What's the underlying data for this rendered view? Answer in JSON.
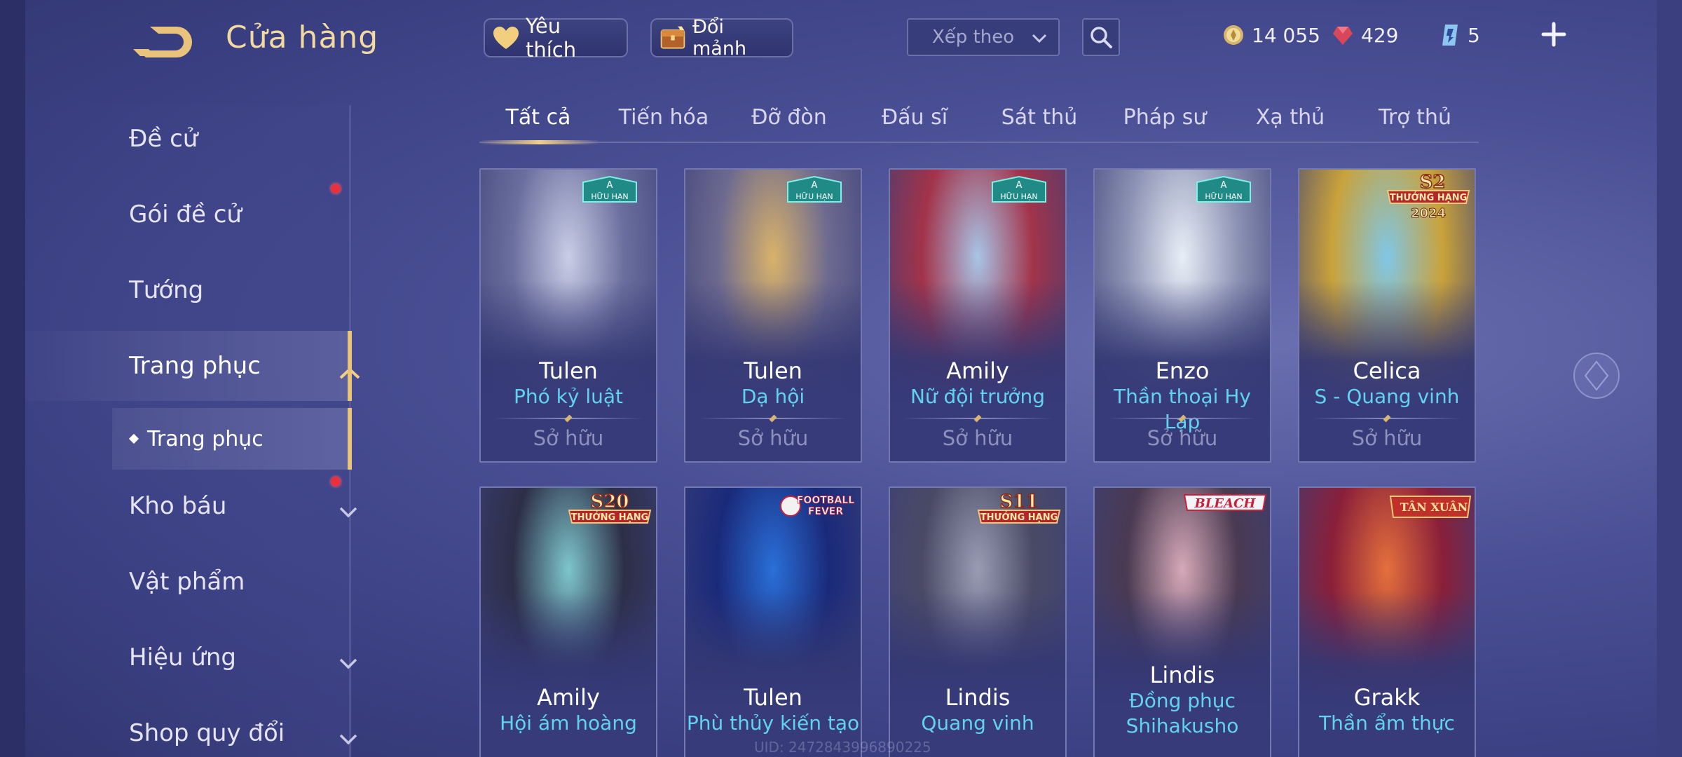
{
  "header": {
    "title": "Cửa hàng",
    "favorite_label": "Yêu thích",
    "fragment_label": "Đổi mảnh",
    "sort_placeholder": "Xếp theo"
  },
  "currency": {
    "gold": "14 055",
    "ruby": "429",
    "voucher": "5"
  },
  "sidebar": {
    "items": [
      {
        "label": "Đề cử"
      },
      {
        "label": "Gói đề cử"
      },
      {
        "label": "Tướng"
      },
      {
        "label": "Trang phục"
      },
      {
        "label": "Kho báu"
      },
      {
        "label": "Vật phẩm"
      },
      {
        "label": "Hiệu ứng"
      },
      {
        "label": "Shop quy đổi"
      }
    ],
    "sub_item": "Trang phục"
  },
  "tabs": [
    "Tất cả",
    "Tiến hóa",
    "Đỡ đòn",
    "Đấu sĩ",
    "Sát thủ",
    "Pháp sư",
    "Xạ thủ",
    "Trợ thủ"
  ],
  "badges": {
    "limited_letter": "A",
    "limited_text": "HỮU HẠN",
    "rank_reward": "THƯỞNG HẠNG",
    "s2": "S2",
    "year_2024": "2024",
    "s20": "S20",
    "s11": "S11",
    "football_1": "FOOTBALL",
    "football_2": "FEVER",
    "bleach": "BLEACH",
    "tan_xuan": "TÂN XUÂN"
  },
  "cards": [
    {
      "hero": "Tulen",
      "skin": "Phó kỷ luật",
      "status": "Sở hữu",
      "colors": [
        "#c9cde6",
        "#6b6f9e",
        "#3b3f78"
      ]
    },
    {
      "hero": "Tulen",
      "skin": "Dạ hội",
      "status": "Sở hữu",
      "colors": [
        "#d9b26a",
        "#6d6a90",
        "#3a3e78"
      ]
    },
    {
      "hero": "Amily",
      "skin": "Nữ đội trưởng",
      "status": "Sở hữu",
      "colors": [
        "#a8c4e6",
        "#a2334a",
        "#3b3f78"
      ]
    },
    {
      "hero": "Enzo",
      "skin": "Thần thoại Hy Lạp",
      "status": "Sở hữu",
      "colors": [
        "#e8eef6",
        "#8d93b4",
        "#3b3f78"
      ]
    },
    {
      "hero": "Celica",
      "skin": "S - Quang vinh",
      "status": "Sở hữu",
      "colors": [
        "#7fc7e6",
        "#c9a23a",
        "#3b3f78"
      ]
    },
    {
      "hero": "Amily",
      "skin": "Hội ám hoàng",
      "status": "",
      "colors": [
        "#7ec6cc",
        "#2d2f48",
        "#3b3f78"
      ]
    },
    {
      "hero": "Tulen",
      "skin": "Phù thủy kiến tạo",
      "status": "",
      "colors": [
        "#2a6fd8",
        "#1a2a7a",
        "#3b3f78"
      ]
    },
    {
      "hero": "Lindis",
      "skin": "Quang vinh",
      "status": "",
      "colors": [
        "#9a9cb4",
        "#4a4a66",
        "#3b3f78"
      ]
    },
    {
      "hero": "Lindis",
      "skin": "Đồng phục Shihakusho",
      "status": "",
      "colors": [
        "#d6a9b8",
        "#4a3a52",
        "#3b3f78"
      ]
    },
    {
      "hero": "Grakk",
      "skin": "Thần ẩm thực",
      "status": "",
      "colors": [
        "#e4703c",
        "#8a1f3a",
        "#3b3f78"
      ]
    }
  ],
  "footer_id": "UID: 2472843996890225",
  "theme": {
    "gold": "#f1d9a0",
    "accent_cyan": "#62d2f0",
    "bg": "#464b90"
  }
}
